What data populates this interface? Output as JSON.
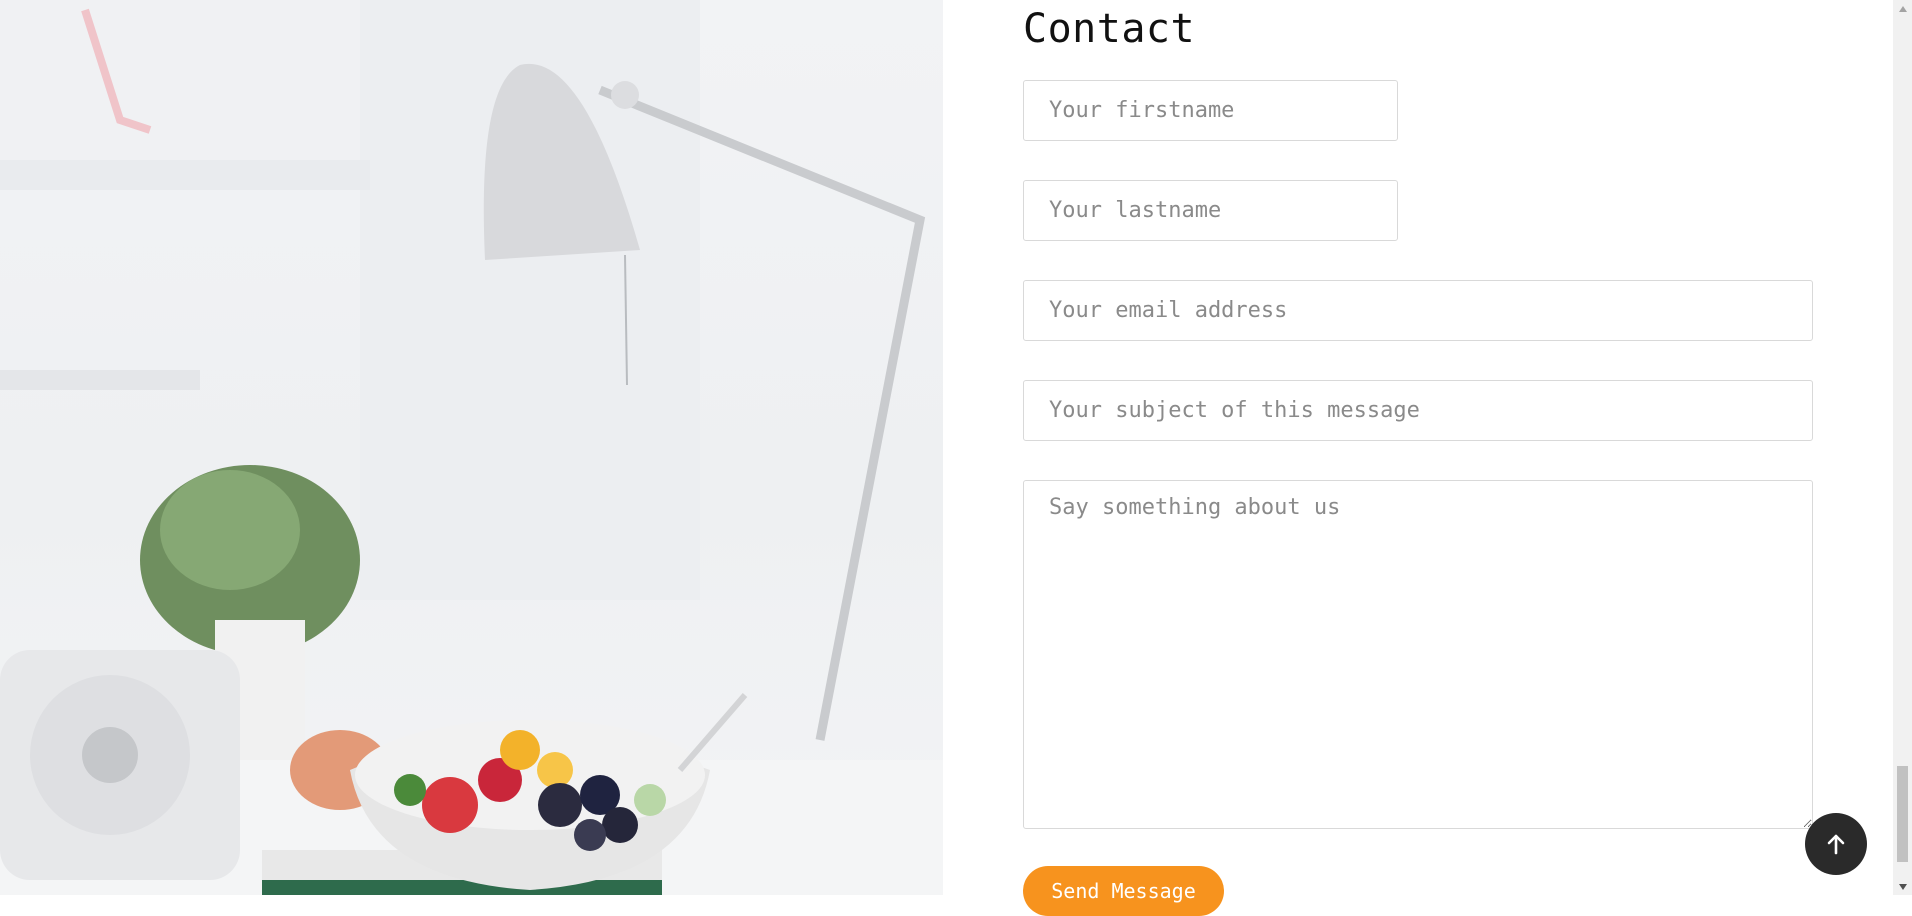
{
  "contact": {
    "title": "Contact",
    "firstname_placeholder": "Your firstname",
    "lastname_placeholder": "Your lastname",
    "email_placeholder": "Your email address",
    "subject_placeholder": "Your subject of this message",
    "message_placeholder": "Say something about us",
    "send_label": "Send Message"
  },
  "colors": {
    "accent": "#f7931e",
    "back_to_top": "#2a2a2a"
  },
  "icons": {
    "back_to_top": "arrow-up-icon"
  }
}
